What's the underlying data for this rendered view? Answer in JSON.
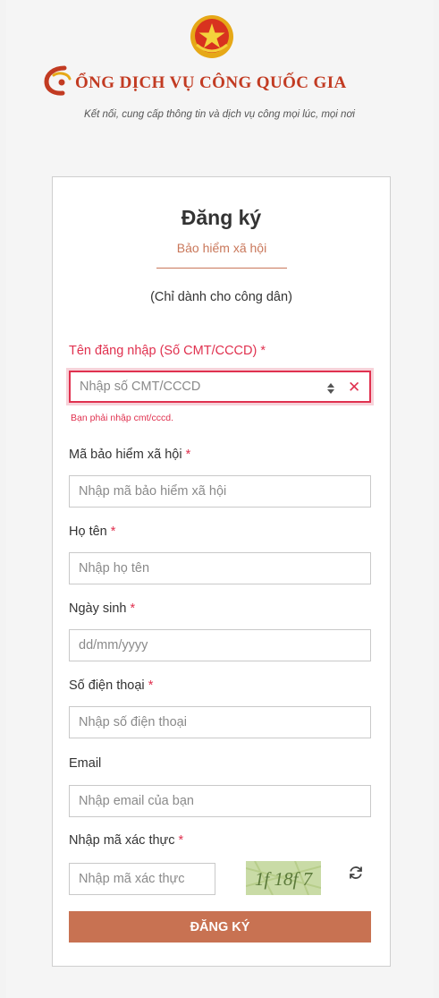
{
  "header": {
    "site_title": "ỔNG DỊCH VỤ CÔNG QUỐC GIA",
    "tagline": "Kết nối, cung cấp thông tin và dịch vụ công mọi lúc, mọi nơi"
  },
  "form": {
    "title": "Đăng ký",
    "active_tab": "Bảo hiểm xã hội",
    "note": "(Chỉ dành cho công dân)",
    "required_marker": "*",
    "fields": [
      {
        "label": "Tên đăng nhập (Số CMT/CCCD)",
        "placeholder": "Nhập số CMT/CCCD",
        "error": "Bạn phải nhập cmt/cccd."
      },
      {
        "label": "Mã bảo hiểm xã hội",
        "placeholder": "Nhập mã bảo hiểm xã hội"
      },
      {
        "label": "Họ tên",
        "placeholder": "Nhập họ tên"
      },
      {
        "label": "Ngày sinh",
        "placeholder": "dd/mm/yyyy"
      },
      {
        "label": "Số điện thoại",
        "placeholder": "Nhập số điện thoại"
      },
      {
        "label": "Email",
        "placeholder": "Nhập email của bạn"
      },
      {
        "label": "Nhập mã xác thực",
        "placeholder": "Nhập mã xác thực"
      }
    ],
    "captcha_text": "1f 18f 7",
    "submit_label": "ĐĂNG KÝ"
  },
  "colors": {
    "accent": "#c87252",
    "error": "#e0314f",
    "brand_red": "#c23b22"
  }
}
